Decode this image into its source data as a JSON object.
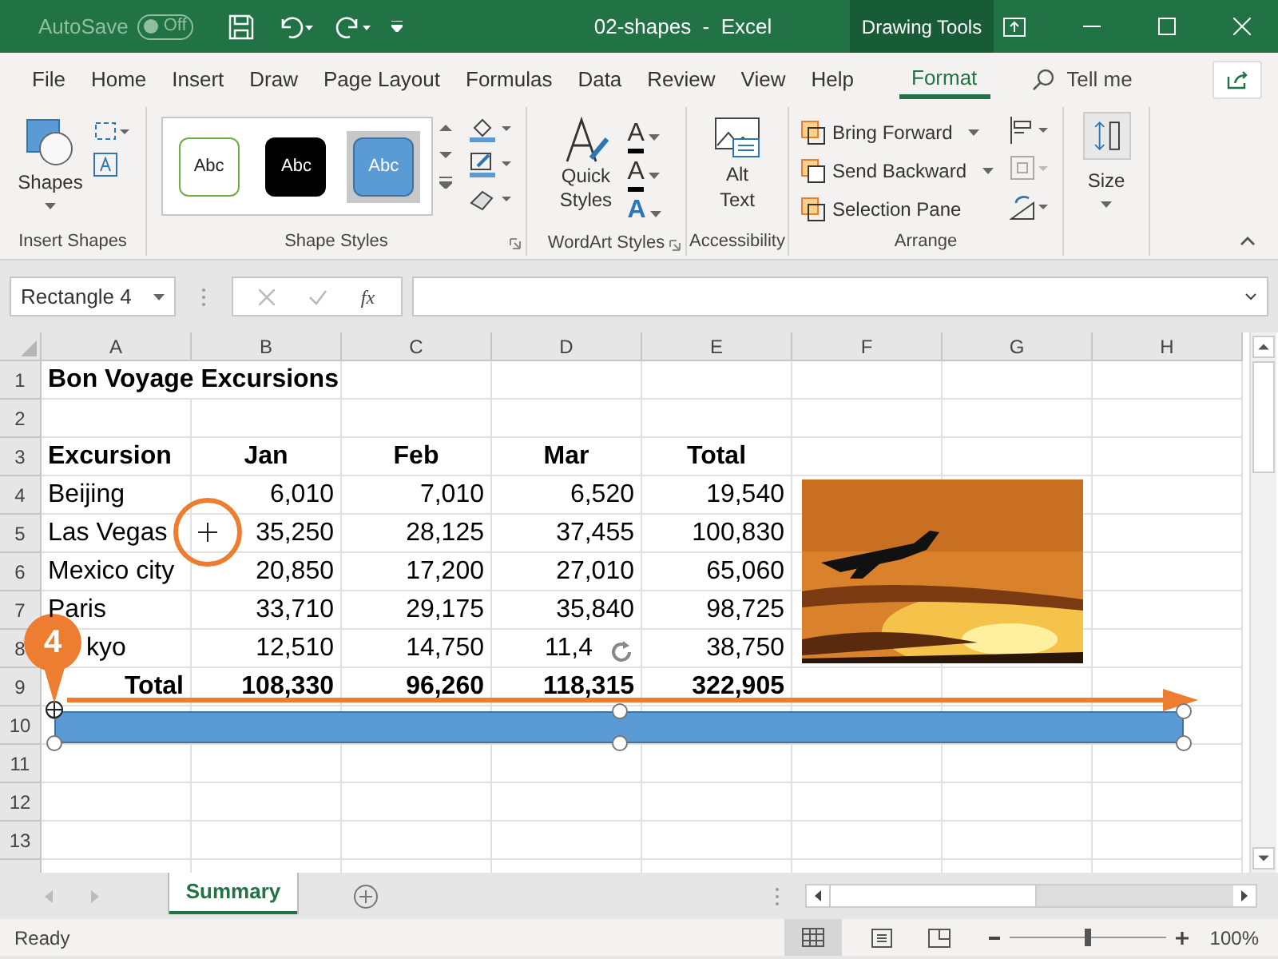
{
  "title_bar": {
    "autosave_label": "AutoSave",
    "autosave_state": "Off",
    "autosave_on": false,
    "document_title": "02-shapes  -  Excel",
    "contextual_tab": "Drawing Tools"
  },
  "menu_tabs": [
    {
      "label": "File",
      "selected": false
    },
    {
      "label": "Home",
      "selected": false
    },
    {
      "label": "Insert",
      "selected": false
    },
    {
      "label": "Draw",
      "selected": false
    },
    {
      "label": "Page Layout",
      "selected": false
    },
    {
      "label": "Formulas",
      "selected": false
    },
    {
      "label": "Data",
      "selected": false
    },
    {
      "label": "Review",
      "selected": false
    },
    {
      "label": "View",
      "selected": false
    },
    {
      "label": "Help",
      "selected": false
    },
    {
      "label": "Format",
      "selected": true
    }
  ],
  "search": {
    "placeholder": "Tell me"
  },
  "ribbon": {
    "insert_shapes": {
      "button": "Shapes",
      "label": "Insert Shapes"
    },
    "shape_styles": {
      "label": "Shape Styles",
      "styles": [
        {
          "label": "Abc",
          "kind": "outline",
          "selected": false
        },
        {
          "label": "Abc",
          "kind": "dark",
          "selected": false
        },
        {
          "label": "Abc",
          "kind": "blue",
          "selected": true
        }
      ]
    },
    "wordart_styles": {
      "button": "Quick Styles",
      "label": "WordArt Styles",
      "letters": [
        "A",
        "A",
        "A"
      ]
    },
    "accessibility": {
      "button": "Alt Text",
      "label": "Accessibility"
    },
    "arrange": {
      "label": "Arrange",
      "buttons": [
        "Bring Forward",
        "Send Backward",
        "Selection Pane"
      ]
    },
    "size": {
      "button": "Size"
    }
  },
  "formula_bar": {
    "name_box": "Rectangle 4",
    "fx": "fx"
  },
  "sheet": {
    "columns": [
      "A",
      "B",
      "C",
      "D",
      "E",
      "F",
      "G",
      "H"
    ],
    "rows": [
      {
        "number": "1",
        "kind": "title",
        "cells": [
          {
            "text": "Bon Voyage Excursions"
          }
        ]
      },
      {
        "number": "2",
        "cells": []
      },
      {
        "number": "3",
        "kind": "header",
        "cells": [
          {
            "text": "Excursion"
          },
          {
            "text": "Jan"
          },
          {
            "text": "Feb"
          },
          {
            "text": "Mar"
          },
          {
            "text": "Total"
          }
        ]
      },
      {
        "number": "4",
        "kind": "data",
        "cells": [
          {
            "text": "Beijing"
          },
          {
            "text": "6,010"
          },
          {
            "text": "7,010"
          },
          {
            "text": "6,520"
          },
          {
            "text": "19,540"
          }
        ]
      },
      {
        "number": "5",
        "kind": "data",
        "cells": [
          {
            "text": "Las Vegas"
          },
          {
            "text": "35,250"
          },
          {
            "text": "28,125"
          },
          {
            "text": "37,455"
          },
          {
            "text": "100,830"
          }
        ]
      },
      {
        "number": "6",
        "kind": "data",
        "cells": [
          {
            "text": "Mexico city"
          },
          {
            "text": "20,850"
          },
          {
            "text": "17,200"
          },
          {
            "text": "27,010"
          },
          {
            "text": "65,060"
          }
        ]
      },
      {
        "number": "7",
        "kind": "data",
        "cells": [
          {
            "text": "Paris"
          },
          {
            "text": "33,710"
          },
          {
            "text": "29,175"
          },
          {
            "text": "35,840"
          },
          {
            "text": "98,725"
          }
        ]
      },
      {
        "number": "8",
        "kind": "data",
        "cells": [
          {
            "text": "kyo",
            "kind": "partial"
          },
          {
            "text": "12,510"
          },
          {
            "text": "14,750"
          },
          {
            "text": "11,4",
            "kind": "partial"
          },
          {
            "text": "38,750"
          }
        ]
      },
      {
        "number": "9",
        "kind": "total",
        "cells": [
          {
            "text": "Total"
          },
          {
            "text": "108,330"
          },
          {
            "text": "96,260"
          },
          {
            "text": "118,315"
          },
          {
            "text": "322,905"
          }
        ]
      },
      {
        "number": "10",
        "cells": []
      },
      {
        "number": "11",
        "cells": []
      },
      {
        "number": "12",
        "cells": []
      },
      {
        "number": "13",
        "cells": []
      }
    ],
    "callout": {
      "number": "4"
    }
  },
  "sheet_tabs": [
    {
      "label": "Summary",
      "selected": true
    }
  ],
  "status_bar": {
    "status": "Ready",
    "zoom": {
      "level": 0.5,
      "reading": "100%"
    }
  }
}
